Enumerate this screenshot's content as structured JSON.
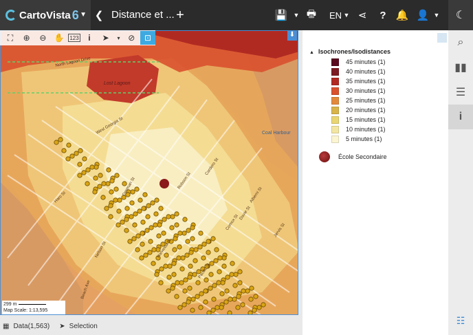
{
  "app": {
    "brand_name": "CartoVista",
    "brand_version": "6",
    "title": "Distance et ...",
    "language": "EN",
    "icons": [
      "caret-down-icon",
      "back-icon",
      "plus-icon",
      "save-icon",
      "print-icon",
      "share-icon",
      "help-icon",
      "bell-icon",
      "user-icon",
      "map-home-icon"
    ]
  },
  "map_tools": [
    "zoom-extent-icon",
    "zoom-in-icon",
    "zoom-out-icon",
    "pan-hand-icon",
    "coordinates-icon",
    "info-icon",
    "select-arrow-icon",
    "measure-icon",
    "active-tool-icon"
  ],
  "map": {
    "labels": [
      {
        "text": "Lost Lagoon"
      },
      {
        "text": "North Lagoon Drive"
      },
      {
        "text": "Coal Harbour"
      },
      {
        "text": "West Georgia St"
      },
      {
        "text": "Denman St"
      },
      {
        "text": "Robson St"
      },
      {
        "text": "Comox St"
      },
      {
        "text": "Nelson St"
      },
      {
        "text": "Harwood St"
      },
      {
        "text": "Pacific St"
      },
      {
        "text": "Beach Ave"
      },
      {
        "text": "Davie St"
      },
      {
        "text": "Cardero St"
      },
      {
        "text": "Alberni St"
      },
      {
        "text": "Jervis St"
      },
      {
        "text": "Haro St"
      }
    ],
    "scale_label": "299 m",
    "map_scale": "Map Scale: 1:13,595"
  },
  "bottombar": {
    "data_label": "Data(1,563)",
    "selection_label": "Selection"
  },
  "legend": {
    "heading": "Isochrones/Isodistances",
    "items": [
      {
        "label": "45 minutes (1)",
        "color": "#5a0a1e"
      },
      {
        "label": "40 minutes (1)",
        "color": "#7c1b22"
      },
      {
        "label": "35 minutes (1)",
        "color": "#b12a22"
      },
      {
        "label": "30 minutes (1)",
        "color": "#d9512d"
      },
      {
        "label": "25 minutes (1)",
        "color": "#e28a3c"
      },
      {
        "label": "20 minutes (1)",
        "color": "#d8b44a"
      },
      {
        "label": "15 minutes (1)",
        "color": "#e9d673"
      },
      {
        "label": "10 minutes (1)",
        "color": "#f3e6a2"
      },
      {
        "label": "5 minutes (1)",
        "color": "#fbf5d2"
      }
    ],
    "school_label": "École Secondaire",
    "school_color": "#8b1a1a"
  },
  "sidebar": [
    "search-icon",
    "chart-icon",
    "layers-icon",
    "info-icon",
    "list-icon"
  ]
}
